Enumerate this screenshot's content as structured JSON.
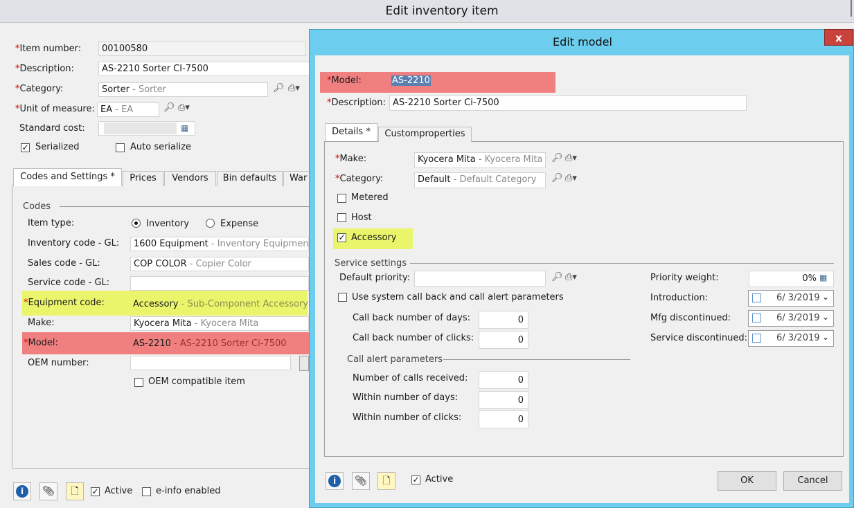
{
  "bg_window": {
    "title": "Edit inventory item",
    "item_number_label": "Item number:",
    "item_number_value": "00100580",
    "description_label": "Description:",
    "description_value": "AS-2210 Sorter CI-7500",
    "category_label": "Category:",
    "category_value": "Sorter",
    "category_sub": " - Sorter",
    "uom_label": "Unit of measure:",
    "uom_value": "EA",
    "uom_sub": " - EA",
    "standard_cost_label": "Standard cost:",
    "serialized_label": "Serialized",
    "auto_serialize_label": "Auto serialize",
    "tabs": [
      "Codes and Settings *",
      "Prices",
      "Vendors",
      "Bin defaults",
      "War"
    ],
    "codes_section": "Codes",
    "item_type_label": "Item type:",
    "item_type_inventory": "Inventory",
    "item_type_expense": "Expense",
    "inventory_code_label": "Inventory code - GL:",
    "inventory_code_value": "1600 Equipment",
    "inventory_code_sub": " - Inventory Equipment",
    "sales_code_label": "Sales code - GL:",
    "sales_code_value": "COP COLOR",
    "sales_code_sub": " - Copier Color",
    "service_code_label": "Service code - GL:",
    "equipment_code_label": "Equipment code:",
    "equipment_code_value": "Accessory",
    "equipment_code_sub": " - Sub-Component Accessory",
    "make_label": "Make:",
    "make_value": "Kyocera Mita",
    "make_sub": " - Kyocera Mita",
    "model_label": "Model:",
    "model_value": "AS-2210",
    "model_sub": " - AS-2210 Sorter Ci-7500",
    "oem_number_label": "OEM number:",
    "oem_compatible_label": "OEM compatible item",
    "active_label": "Active",
    "einfo_label": "e-info enabled",
    "required_mark": "*"
  },
  "dialog": {
    "title": "Edit model",
    "close_glyph": "x",
    "model_label": "Model:",
    "model_value": "AS-2210",
    "description_label": "Description:",
    "description_value": "AS-2210 Sorter Ci-7500",
    "tabs": [
      "Details *",
      "Customproperties"
    ],
    "make_label": "Make:",
    "make_value": "Kyocera Mita",
    "make_sub": " - Kyocera Mita",
    "category_label": "Category:",
    "category_value": "Default",
    "category_sub": " - Default Category",
    "metered_label": "Metered",
    "host_label": "Host",
    "accessory_label": "Accessory",
    "service_settings": "Service settings",
    "default_priority_label": "Default priority:",
    "use_system_label": "Use system call back and call alert parameters",
    "callback_days_label": "Call back number of days:",
    "callback_days_value": "0",
    "callback_clicks_label": "Call back number of clicks:",
    "callback_clicks_value": "0",
    "call_alert_section": "Call alert parameters",
    "calls_received_label": "Number of calls received:",
    "calls_received_value": "0",
    "within_days_label": "Within number of days:",
    "within_days_value": "0",
    "within_clicks_label": "Within number of clicks:",
    "within_clicks_value": "0",
    "priority_weight_label": "Priority weight:",
    "priority_weight_value": "0%",
    "introduction_label": "Introduction:",
    "introduction_value": "6/ 3/2019",
    "mfg_discontinued_label": "Mfg discontinued:",
    "mfg_discontinued_value": "6/ 3/2019",
    "service_discontinued_label": "Service discontinued:",
    "service_discontinued_value": "6/ 3/2019",
    "active_label": "Active",
    "ok_label": "OK",
    "cancel_label": "Cancel"
  },
  "colors": {
    "dialog_frame": "#6ccdee",
    "highlight_yellow": "#eaf56c",
    "highlight_red": "#f08080",
    "required": "#d40000"
  }
}
